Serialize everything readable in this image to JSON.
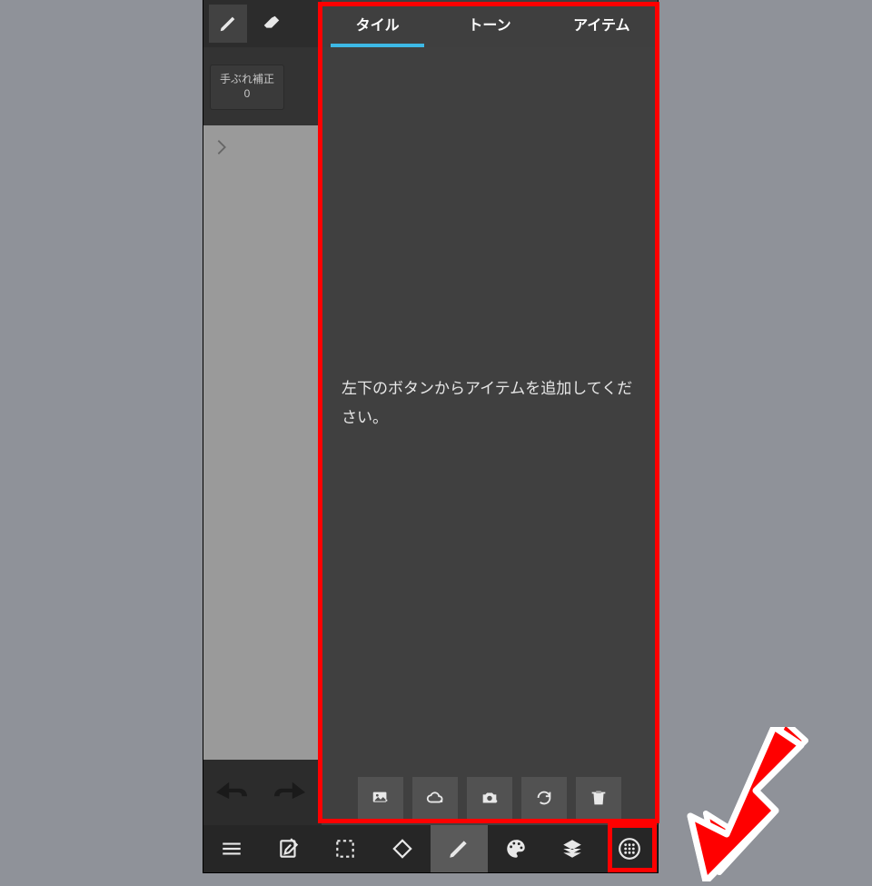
{
  "tabs": {
    "tile": "タイル",
    "tone": "トーン",
    "item": "アイテム"
  },
  "stabilization": {
    "label": "手ぶれ補正",
    "value": "0"
  },
  "panel": {
    "emptyMessage": "左下のボタンからアイテムを追加してください。"
  },
  "panelToolbar": {
    "image": "image-add",
    "cloud": "cloud-add",
    "camera": "camera-add",
    "reload": "reload",
    "trash": "trash"
  },
  "bottomBar": {
    "menu": "menu",
    "edit": "edit",
    "select": "select",
    "rotate": "rotate",
    "brush": "brush",
    "palette": "palette",
    "layers": "layers",
    "materials": "materials"
  },
  "topTools": {
    "pencil": "pencil",
    "eraser": "eraser"
  },
  "undoBar": {
    "undo": "undo",
    "redo": "redo"
  }
}
